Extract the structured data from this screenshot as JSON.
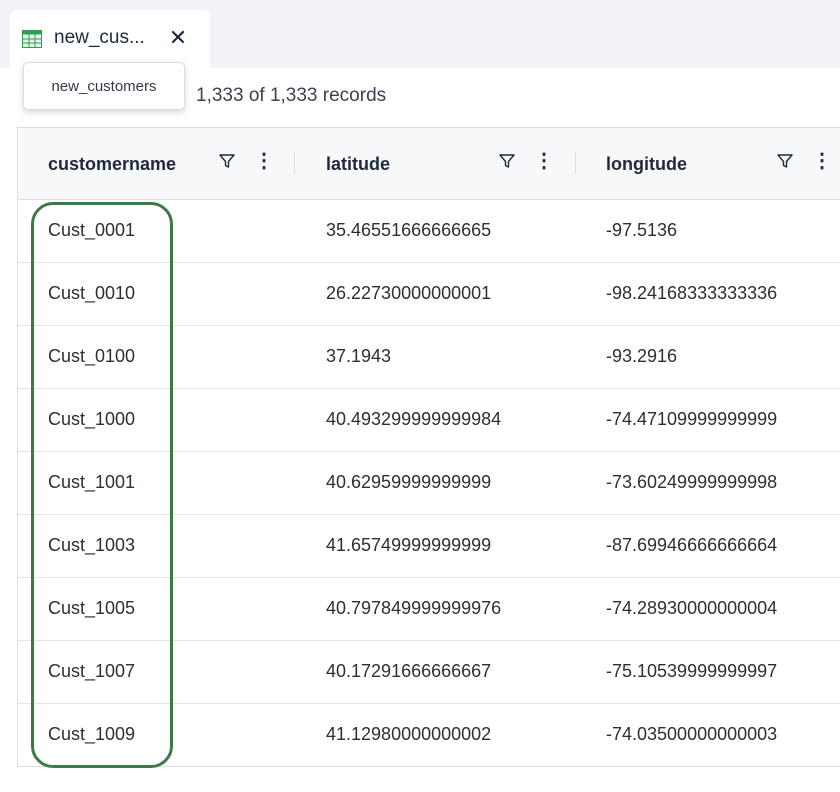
{
  "tab": {
    "title": "new_cus...",
    "close_label": "✕",
    "icon": "table-grid-icon",
    "tooltip": "new_customers"
  },
  "records_count": "1,333 of 1,333 records",
  "columns": [
    {
      "label": "customername",
      "filter_icon": "filter-icon",
      "menu_icon": "more-vertical-icon"
    },
    {
      "label": "latitude",
      "filter_icon": "filter-icon",
      "menu_icon": "more-vertical-icon"
    },
    {
      "label": "longitude",
      "filter_icon": "filter-icon",
      "menu_icon": "more-vertical-icon"
    }
  ],
  "rows": [
    {
      "customername": "Cust_0001",
      "latitude": "35.46551666666665",
      "longitude": "-97.5136"
    },
    {
      "customername": "Cust_0010",
      "latitude": "26.22730000000001",
      "longitude": "-98.24168333333336"
    },
    {
      "customername": "Cust_0100",
      "latitude": "37.1943",
      "longitude": "-93.2916"
    },
    {
      "customername": "Cust_1000",
      "latitude": "40.493299999999984",
      "longitude": "-74.47109999999999"
    },
    {
      "customername": "Cust_1001",
      "latitude": "40.62959999999999",
      "longitude": "-73.60249999999998"
    },
    {
      "customername": "Cust_1003",
      "latitude": "41.65749999999999",
      "longitude": "-87.69946666666664"
    },
    {
      "customername": "Cust_1005",
      "latitude": "40.797849999999976",
      "longitude": "-74.28930000000004"
    },
    {
      "customername": "Cust_1007",
      "latitude": "40.17291666666667",
      "longitude": "-75.10539999999997"
    },
    {
      "customername": "Cust_1009",
      "latitude": "41.12980000000002",
      "longitude": "-74.03500000000003"
    }
  ],
  "colors": {
    "tab_bar_bg": "#f2f3f6",
    "table_icon": "#2e9e4f",
    "highlight_outline": "#3f7a46",
    "header_bg": "#f7f8fa"
  }
}
